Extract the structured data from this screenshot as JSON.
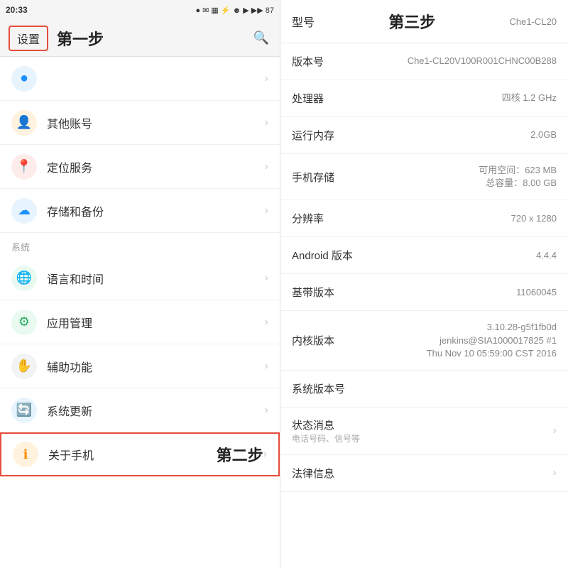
{
  "statusBar": {
    "time": "20:33",
    "icons": "● ✉ ▦ ⚡ ☻ ▲ ▲▲▲ 87"
  },
  "leftPanel": {
    "settingsLabel": "设置",
    "headerTitle": "第一步",
    "sectionSystem": "系统",
    "menuItems": [
      {
        "id": "item1",
        "label": "",
        "iconColor": "#1e90ff",
        "iconSymbol": "●",
        "highlighted": false
      },
      {
        "id": "other-account",
        "label": "其他账号",
        "iconColor": "#ff8c00",
        "iconSymbol": "👤",
        "highlighted": false
      },
      {
        "id": "location",
        "label": "定位服务",
        "iconColor": "#e74c3c",
        "iconSymbol": "📍",
        "highlighted": false
      },
      {
        "id": "storage",
        "label": "存储和备份",
        "iconColor": "#1e90ff",
        "iconSymbol": "☁",
        "highlighted": false
      },
      {
        "id": "language",
        "label": "语言和时间",
        "iconColor": "#27ae60",
        "iconSymbol": "🌐",
        "highlighted": false
      },
      {
        "id": "app-mgmt",
        "label": "应用管理",
        "iconColor": "#27ae60",
        "iconSymbol": "⚙",
        "highlighted": false
      },
      {
        "id": "accessibility",
        "label": "辅助功能",
        "iconColor": "#7f8c8d",
        "iconSymbol": "✋",
        "highlighted": false
      },
      {
        "id": "system-update",
        "label": "系统更新",
        "iconColor": "#1e90ff",
        "iconSymbol": "🔄",
        "highlighted": false
      },
      {
        "id": "about-phone",
        "label": "关于手机",
        "iconColor": "#ff8c00",
        "iconSymbol": "ℹ",
        "highlighted": true
      }
    ],
    "step2Label": "第二步"
  },
  "rightPanel": {
    "headerLeft": "型号",
    "headerCenter": "第三步",
    "headerRight": "Che1-CL20",
    "rows": [
      {
        "id": "version-num",
        "label": "版本号",
        "value": "Che1-CL20V100R001CHNC00B288",
        "clickable": false
      },
      {
        "id": "processor",
        "label": "处理器",
        "value": "四核 1.2 GHz",
        "clickable": false
      },
      {
        "id": "ram",
        "label": "运行内存",
        "value": "2.0GB",
        "clickable": false
      },
      {
        "id": "storage",
        "label": "手机存储",
        "value": "可用空间：623 MB\n总容量：8.00 GB",
        "clickable": false
      },
      {
        "id": "resolution",
        "label": "分辨率",
        "value": "720 x 1280",
        "clickable": false
      },
      {
        "id": "android-ver",
        "label": "Android 版本",
        "value": "4.4.4",
        "clickable": false
      },
      {
        "id": "baseband",
        "label": "基带版本",
        "value": "11060045",
        "clickable": false
      },
      {
        "id": "kernel",
        "label": "内核版本",
        "value": "3.10.28-g5f1fb0d\njenkins@SIA1000017825 #1\nThu Nov 10 05:59:00 CST 2016",
        "clickable": false
      },
      {
        "id": "sys-version",
        "label": "系统版本号",
        "value": "",
        "clickable": false
      },
      {
        "id": "status",
        "label": "状态消息",
        "sublabel": "电话号码、信号等",
        "value": "",
        "clickable": true
      },
      {
        "id": "legal",
        "label": "法律信息",
        "value": "",
        "clickable": true
      }
    ]
  }
}
